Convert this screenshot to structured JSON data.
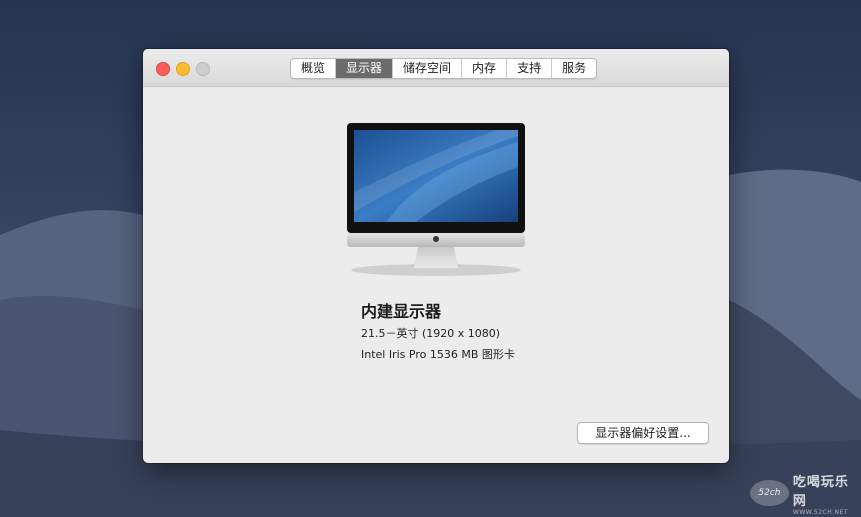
{
  "window": {
    "tabs": [
      {
        "label": "概览"
      },
      {
        "label": "显示器"
      },
      {
        "label": "储存空间"
      },
      {
        "label": "内存"
      },
      {
        "label": "支持"
      },
      {
        "label": "服务"
      }
    ],
    "active_tab": "显示器"
  },
  "display": {
    "name": "内建显示器",
    "size_resolution": "21.5－英寸 (1920 x 1080)",
    "graphics": "Intel Iris Pro 1536 MB 图形卡",
    "preferences_button": "显示器偏好设置..."
  },
  "watermark": {
    "logo_text": "52ch",
    "site_name": "吃喝玩乐网",
    "url": "WWW.52CH.NET"
  },
  "colors": {
    "close": "#fc5b57",
    "minimize": "#fdbb2e",
    "zoom_disabled": "#cdcdcd",
    "active_tab_bg": "#6b6b6b"
  }
}
